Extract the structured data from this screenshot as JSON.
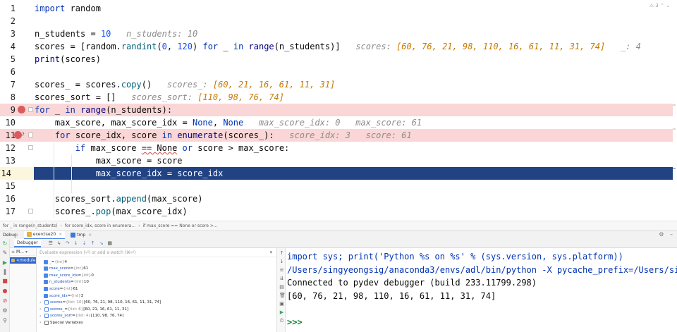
{
  "editor": {
    "inspector_text": "⚠ 3 ⌃ ⌄",
    "lines": [
      {
        "n": "1",
        "kind": "normal",
        "tokens": [
          {
            "t": "import",
            "c": "kw"
          },
          {
            "t": " random",
            "c": ""
          }
        ]
      },
      {
        "n": "2",
        "kind": "normal",
        "tokens": []
      },
      {
        "n": "3",
        "kind": "normal",
        "tokens": [
          {
            "t": "n_students",
            "c": ""
          },
          {
            "t": " = ",
            "c": ""
          },
          {
            "t": "10",
            "c": "num"
          },
          {
            "t": "   n_students: 10",
            "c": "hint"
          }
        ]
      },
      {
        "n": "4",
        "kind": "normal",
        "tokens": [
          {
            "t": "scores = [random.",
            "c": ""
          },
          {
            "t": "randint",
            "c": "fn"
          },
          {
            "t": "(",
            "c": ""
          },
          {
            "t": "0",
            "c": "num"
          },
          {
            "t": ", ",
            "c": ""
          },
          {
            "t": "120",
            "c": "num"
          },
          {
            "t": ") ",
            "c": ""
          },
          {
            "t": "for",
            "c": "kw"
          },
          {
            "t": " _ ",
            "c": ""
          },
          {
            "t": "in",
            "c": "kw"
          },
          {
            "t": " ",
            "c": ""
          },
          {
            "t": "range",
            "c": "bi"
          },
          {
            "t": "(n_students)]",
            "c": ""
          },
          {
            "t": "   scores: ",
            "c": "hint"
          },
          {
            "t": "[60, 76, 21, 98, 110, 16, 61, 11, 31, 74]",
            "c": "hintv"
          },
          {
            "t": "   _: 4",
            "c": "hint"
          }
        ]
      },
      {
        "n": "5",
        "kind": "normal",
        "tokens": [
          {
            "t": "print",
            "c": "bi"
          },
          {
            "t": "(scores)",
            "c": ""
          }
        ]
      },
      {
        "n": "6",
        "kind": "normal",
        "tokens": []
      },
      {
        "n": "7",
        "kind": "normal",
        "tokens": [
          {
            "t": "scores_ = scores.",
            "c": ""
          },
          {
            "t": "copy",
            "c": "fn"
          },
          {
            "t": "()",
            "c": ""
          },
          {
            "t": "   scores_: ",
            "c": "hint"
          },
          {
            "t": "[60, 21, 16, 61, 11, 31]",
            "c": "hintv"
          }
        ]
      },
      {
        "n": "8",
        "kind": "normal",
        "tokens": [
          {
            "t": "scores_sort = []",
            "c": ""
          },
          {
            "t": "   scores_sort: ",
            "c": "hint"
          },
          {
            "t": "[110, 98, 76, 74]",
            "c": "hintv"
          }
        ]
      },
      {
        "n": "9",
        "kind": "bp",
        "tokens": [
          {
            "t": "for",
            "c": "kw"
          },
          {
            "t": " _ ",
            "c": ""
          },
          {
            "t": "in",
            "c": "kw"
          },
          {
            "t": " ",
            "c": ""
          },
          {
            "t": "range",
            "c": "bi"
          },
          {
            "t": "(n_students):",
            "c": ""
          }
        ]
      },
      {
        "n": "10",
        "kind": "normal",
        "tokens": [
          {
            "t": "    max_score, max_score_idx = ",
            "c": ""
          },
          {
            "t": "None",
            "c": "kw"
          },
          {
            "t": ", ",
            "c": ""
          },
          {
            "t": "None",
            "c": "kw"
          },
          {
            "t": "   max_score_idx: 0",
            "c": "hint"
          },
          {
            "t": "   max_score: 61",
            "c": "hint"
          }
        ]
      },
      {
        "n": "11",
        "kind": "bp",
        "tokens": [
          {
            "t": "    ",
            "c": ""
          },
          {
            "t": "for",
            "c": "kw"
          },
          {
            "t": " score_idx, score ",
            "c": ""
          },
          {
            "t": "in",
            "c": "kw"
          },
          {
            "t": " ",
            "c": ""
          },
          {
            "t": "enumerate",
            "c": "bi"
          },
          {
            "t": "(scores_):",
            "c": ""
          },
          {
            "t": "   score_idx: 3",
            "c": "hint"
          },
          {
            "t": "   score: 61",
            "c": "hint"
          }
        ]
      },
      {
        "n": "12",
        "kind": "normal",
        "tokens": [
          {
            "t": "        ",
            "c": ""
          },
          {
            "t": "if",
            "c": "kw"
          },
          {
            "t": " max_score ",
            "c": ""
          },
          {
            "t": "== None",
            "c": "squig"
          },
          {
            "t": " ",
            "c": ""
          },
          {
            "t": "or",
            "c": "kw"
          },
          {
            "t": " score > max_score:",
            "c": ""
          }
        ]
      },
      {
        "n": "13",
        "kind": "normal",
        "tokens": [
          {
            "t": "            max_score = score",
            "c": ""
          }
        ]
      },
      {
        "n": "14",
        "kind": "cur",
        "tokens": [
          {
            "t": "            max_score_idx = score_idx",
            "c": ""
          }
        ]
      },
      {
        "n": "15",
        "kind": "normal",
        "tokens": []
      },
      {
        "n": "16",
        "kind": "normal",
        "tokens": [
          {
            "t": "    scores_sort.",
            "c": ""
          },
          {
            "t": "append",
            "c": "fn"
          },
          {
            "t": "(max_score)",
            "c": ""
          }
        ]
      },
      {
        "n": "17",
        "kind": "normal",
        "tokens": [
          {
            "t": "    scores_.",
            "c": ""
          },
          {
            "t": "pop",
            "c": "fn"
          },
          {
            "t": "(max_score_idx)",
            "c": ""
          }
        ]
      }
    ]
  },
  "breadcrumb": [
    "for _ in range(n_students)",
    "for score_idx, score in enumera...",
    "if max_score == None or score >..."
  ],
  "debug_tabs": {
    "label": "Debug:",
    "tabs": [
      {
        "label": "exercise20",
        "active": true
      },
      {
        "label": "tmp",
        "active": false
      }
    ]
  },
  "debugger": {
    "tab_label": "Debugger",
    "frames_header": "M...",
    "frame_selected": "<module",
    "eval_placeholder": "Evaluate expression (⏎) or add a watch (⌘⏎)",
    "variables": [
      {
        "expand": false,
        "icon": "prim",
        "name": "_",
        "type": "{int}",
        "value": "4"
      },
      {
        "expand": false,
        "icon": "prim",
        "name": "max_score",
        "type": "{int}",
        "value": "61"
      },
      {
        "expand": false,
        "icon": "prim",
        "name": "max_score_idx",
        "type": "{int}",
        "value": "0"
      },
      {
        "expand": false,
        "icon": "prim",
        "name": "n_students",
        "type": "{int}",
        "value": "10"
      },
      {
        "expand": false,
        "icon": "prim",
        "name": "score",
        "type": "{int}",
        "value": "61"
      },
      {
        "expand": false,
        "icon": "prim",
        "name": "score_idx",
        "type": "{int}",
        "value": "3"
      },
      {
        "expand": true,
        "icon": "list",
        "name": "scores",
        "type": "{list: 10}",
        "value": "[60, 76, 21, 98, 110, 16, 61, 11, 31, 74]"
      },
      {
        "expand": true,
        "icon": "list",
        "name": "scores_",
        "type": "{list: 6}",
        "value": "[60, 21, 16, 61, 11, 31]"
      },
      {
        "expand": true,
        "icon": "list",
        "name": "scores_sort",
        "type": "{list: 4}",
        "value": "[110, 98, 76, 74]"
      },
      {
        "expand": true,
        "icon": "spec",
        "name": "Special Variables",
        "type": "",
        "value": ""
      }
    ]
  },
  "console": {
    "lines": [
      {
        "text": "import sys; print('Python %s on %s' % (sys.version, sys.platform))",
        "c": "c-blue"
      },
      {
        "text": "/Users/singyeongsig/anaconda3/envs/adl/bin/python -X pycache_prefix=/Users/singyeong",
        "c": "c-blue"
      },
      {
        "text": "Connected to pydev debugger (build 233.11799.298)",
        "c": "c-black"
      },
      {
        "text": "[60, 76, 21, 98, 110, 16, 61, 11, 31, 74]",
        "c": "c-black"
      },
      {
        "text": "",
        "c": "c-black"
      },
      {
        "text": ">>>",
        "c": "c-prompt"
      }
    ]
  },
  "colors": {
    "breakpoint_line": "#fad6d6",
    "current_line": "#214283",
    "breakpoint_dot": "#db5c5c",
    "keyword": "#0033b3",
    "inline_hint_value": "#c77a00"
  }
}
